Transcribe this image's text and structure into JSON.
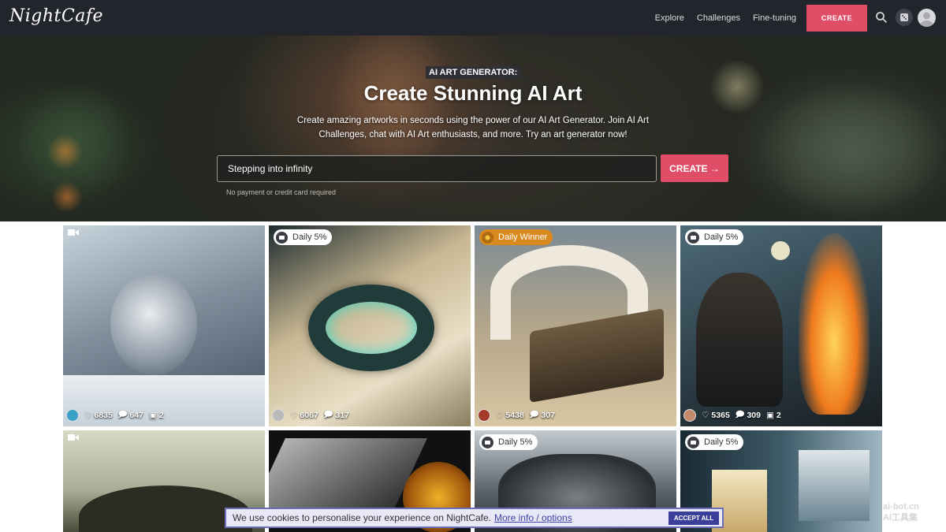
{
  "nav": {
    "logo": "NightCafe",
    "links": [
      "Explore",
      "Challenges",
      "Fine-tuning"
    ],
    "create_label": "CREATE"
  },
  "hero": {
    "label": "AI ART GENERATOR:",
    "title": "Create Stunning AI Art",
    "subtitle": "Create amazing artworks in seconds using the power of our AI Art Generator. Join AI Art Challenges, chat with AI Art enthusiasts, and more. Try an art generator now!",
    "prompt_value": "Stepping into infinity",
    "create_label": "CREATE →",
    "note": "No payment or credit card required"
  },
  "cards": [
    {
      "badge": "",
      "video": true,
      "likes": "6835",
      "comments": "647",
      "images": "2"
    },
    {
      "badge": "Daily 5%",
      "video": false,
      "likes": "6067",
      "comments": "317",
      "images": ""
    },
    {
      "badge": "Daily Winner",
      "video": false,
      "likes": "5438",
      "comments": "307",
      "images": ""
    },
    {
      "badge": "Daily 5%",
      "video": false,
      "likes": "5365",
      "comments": "309",
      "images": "2"
    },
    {
      "badge": "",
      "video": true
    },
    {
      "badge": "",
      "video": false
    },
    {
      "badge": "Daily 5%",
      "video": false
    },
    {
      "badge": "Daily 5%",
      "video": false
    }
  ],
  "cookie": {
    "text": "We use cookies to personalise your experience on NightCafe.",
    "link": "More info / options",
    "accept": "ACCEPT ALL"
  },
  "watermark": {
    "line1": "ai-bot.cn",
    "line2": "AI工具集"
  },
  "colors": {
    "accent": "#e04d67",
    "nav_bg": "#23252c",
    "cookie_btn": "#3b3f9a",
    "winner": "#d98a1e"
  }
}
